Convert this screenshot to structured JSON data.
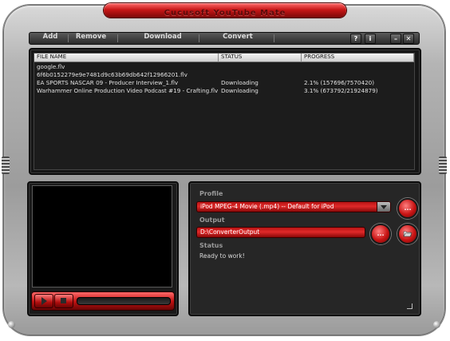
{
  "app": {
    "title": "Cucusoft YouTube Mate"
  },
  "menu": {
    "add": "Add",
    "remove": "Remove",
    "download": "Download",
    "convert": "Convert",
    "help": "?",
    "info": "i",
    "minimize": "–",
    "close": "✕"
  },
  "file_list": {
    "headers": {
      "name": "FILE NAME",
      "status": "STATUS",
      "progress": "PROGRESS"
    },
    "rows": [
      {
        "name": "google.flv",
        "status": "",
        "progress": ""
      },
      {
        "name": "6f6b0152279e9e7481d9c63b69db642f12966201.flv",
        "status": "",
        "progress": ""
      },
      {
        "name": "EA SPORTS NASCAR 09 - Producer Interview_1.flv",
        "status": "Downloading",
        "progress": "2.1% (157696/7570420)"
      },
      {
        "name": "Warhammer Online Production Video Podcast #19 - Crafting.flv",
        "status": "Downloading",
        "progress": "3.1% (673792/21924879)"
      }
    ]
  },
  "player": {
    "play_icon": "play-icon",
    "stop_icon": "stop-icon",
    "seek_position": 0
  },
  "settings": {
    "profile_label": "Profile",
    "profile_value": "iPod  MPEG-4 Movie (.mp4) -- Default for iPod",
    "output_label": "Output",
    "output_value": "D:\\ConverterOutput",
    "status_label": "Status",
    "status_value": "Ready to work!",
    "more_button": "...",
    "browse_button": "...",
    "folder_icon": "folder-open-icon"
  },
  "colors": {
    "accent_red": "#c81414",
    "panel_dark": "#1c1c1c",
    "chrome": "#b4b4b4"
  }
}
